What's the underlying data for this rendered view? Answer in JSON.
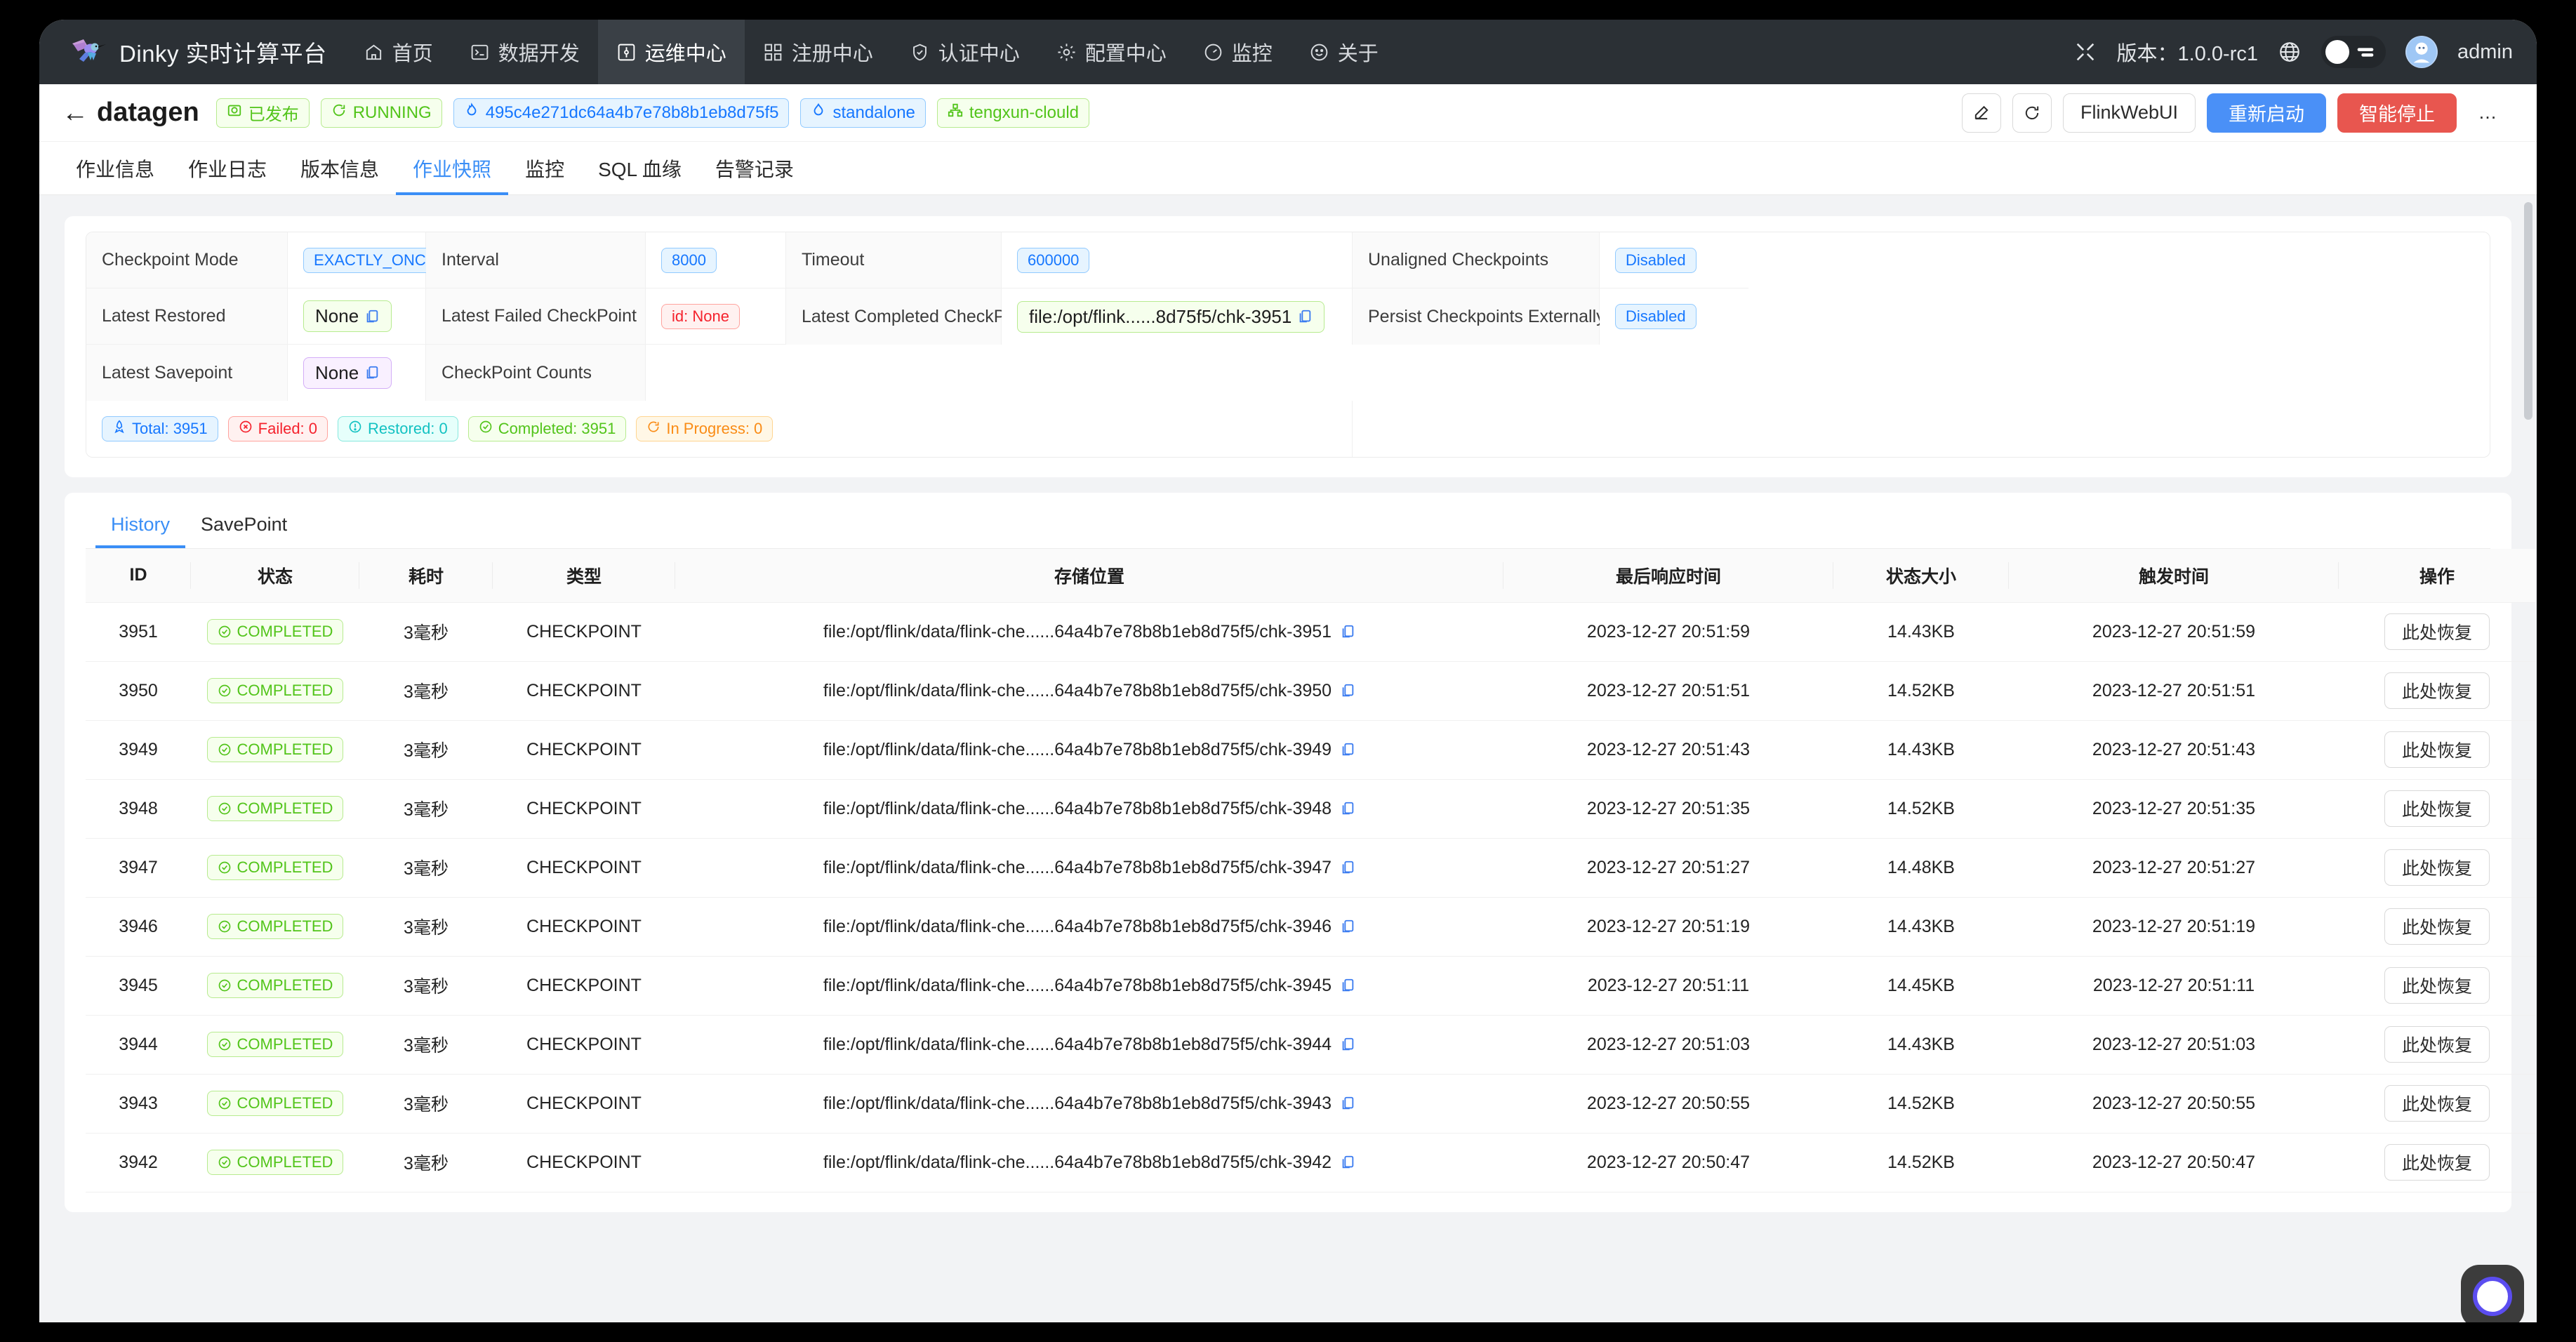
{
  "topnav": {
    "brand": "Dinky 实时计算平台",
    "items": [
      {
        "label": "首页",
        "icon": "home-icon",
        "active": false
      },
      {
        "label": "数据开发",
        "icon": "terminal-icon",
        "active": false
      },
      {
        "label": "运维中心",
        "icon": "ops-icon",
        "active": true
      },
      {
        "label": "注册中心",
        "icon": "registry-icon",
        "active": false
      },
      {
        "label": "认证中心",
        "icon": "shield-icon",
        "active": false
      },
      {
        "label": "配置中心",
        "icon": "gear-icon",
        "active": false
      },
      {
        "label": "监控",
        "icon": "dashboard-icon",
        "active": false
      },
      {
        "label": "关于",
        "icon": "smile-icon",
        "active": false
      }
    ],
    "version_label": "版本：1.0.0-rc1",
    "user": "admin"
  },
  "jobheader": {
    "title": "datagen",
    "tags": [
      {
        "label": "已发布",
        "color": "green",
        "icon": "publish-icon"
      },
      {
        "label": "RUNNING",
        "color": "green",
        "icon": "running-icon"
      },
      {
        "label": "495c4e271dc64a4b7e78b8b1eb8d75f5",
        "color": "blue",
        "icon": "fire-icon"
      },
      {
        "label": "standalone",
        "color": "blue",
        "icon": "cluster-icon"
      },
      {
        "label": "tengxun-clould",
        "color": "green",
        "icon": "group-icon"
      }
    ],
    "actions": {
      "edit": "edit-icon",
      "refresh": "refresh-icon",
      "flink_web_ui": "FlinkWebUI",
      "restart": "重新启动",
      "smart_stop": "智能停止",
      "more": "…"
    }
  },
  "tabs": [
    {
      "label": "作业信息",
      "active": false
    },
    {
      "label": "作业日志",
      "active": false
    },
    {
      "label": "版本信息",
      "active": false
    },
    {
      "label": "作业快照",
      "active": true
    },
    {
      "label": "监控",
      "active": false
    },
    {
      "label": "SQL 血缘",
      "active": false
    },
    {
      "label": "告警记录",
      "active": false
    }
  ],
  "checkpoint_info": {
    "row1": {
      "mode_label": "Checkpoint Mode",
      "mode_value": "EXACTLY_ONCE",
      "interval_label": "Interval",
      "interval_value": "8000",
      "timeout_label": "Timeout",
      "timeout_value": "600000",
      "unaligned_label": "Unaligned Checkpoints",
      "unaligned_value": "Disabled"
    },
    "row2": {
      "latest_restored_label": "Latest Restored",
      "latest_restored_value": "None",
      "latest_failed_label": "Latest Failed CheckPoint",
      "latest_failed_value": "id: None",
      "latest_completed_label": "Latest Completed CheckPoint",
      "latest_completed_value": "file:/opt/flink......8d75f5/chk-3951",
      "persist_label": "Persist Checkpoints Externally Enabled",
      "persist_value": "Disabled"
    },
    "row3": {
      "latest_savepoint_label": "Latest Savepoint",
      "latest_savepoint_value": "None",
      "counts_label": "CheckPoint Counts",
      "counts": [
        {
          "label": "Total: 3951",
          "color": "blue",
          "icon": "rocket-icon"
        },
        {
          "label": "Failed: 0",
          "color": "red",
          "icon": "close-circle-icon"
        },
        {
          "label": "Restored: 0",
          "color": "cyan",
          "icon": "exclamation-circle-icon"
        },
        {
          "label": "Completed: 3951",
          "color": "green",
          "icon": "check-circle-icon"
        },
        {
          "label": "In Progress: 0",
          "color": "orange",
          "icon": "loading-icon"
        }
      ]
    }
  },
  "subtabs": [
    {
      "label": "History",
      "active": true
    },
    {
      "label": "SavePoint",
      "active": false
    }
  ],
  "table": {
    "columns": [
      "ID",
      "状态",
      "耗时",
      "类型",
      "存储位置",
      "最后响应时间",
      "状态大小",
      "触发时间",
      "操作"
    ],
    "action_label": "此处恢复",
    "rows": [
      {
        "id": "3951",
        "status": "COMPLETED",
        "duration": "3毫秒",
        "type": "CHECKPOINT",
        "path": "file:/opt/flink/data/flink-che......64a4b7e78b8b1eb8d75f5/chk-3951",
        "last_ack": "2023-12-27 20:51:59",
        "size": "14.43KB",
        "trigger": "2023-12-27 20:51:59"
      },
      {
        "id": "3950",
        "status": "COMPLETED",
        "duration": "3毫秒",
        "type": "CHECKPOINT",
        "path": "file:/opt/flink/data/flink-che......64a4b7e78b8b1eb8d75f5/chk-3950",
        "last_ack": "2023-12-27 20:51:51",
        "size": "14.52KB",
        "trigger": "2023-12-27 20:51:51"
      },
      {
        "id": "3949",
        "status": "COMPLETED",
        "duration": "3毫秒",
        "type": "CHECKPOINT",
        "path": "file:/opt/flink/data/flink-che......64a4b7e78b8b1eb8d75f5/chk-3949",
        "last_ack": "2023-12-27 20:51:43",
        "size": "14.43KB",
        "trigger": "2023-12-27 20:51:43"
      },
      {
        "id": "3948",
        "status": "COMPLETED",
        "duration": "3毫秒",
        "type": "CHECKPOINT",
        "path": "file:/opt/flink/data/flink-che......64a4b7e78b8b1eb8d75f5/chk-3948",
        "last_ack": "2023-12-27 20:51:35",
        "size": "14.52KB",
        "trigger": "2023-12-27 20:51:35"
      },
      {
        "id": "3947",
        "status": "COMPLETED",
        "duration": "3毫秒",
        "type": "CHECKPOINT",
        "path": "file:/opt/flink/data/flink-che......64a4b7e78b8b1eb8d75f5/chk-3947",
        "last_ack": "2023-12-27 20:51:27",
        "size": "14.48KB",
        "trigger": "2023-12-27 20:51:27"
      },
      {
        "id": "3946",
        "status": "COMPLETED",
        "duration": "3毫秒",
        "type": "CHECKPOINT",
        "path": "file:/opt/flink/data/flink-che......64a4b7e78b8b1eb8d75f5/chk-3946",
        "last_ack": "2023-12-27 20:51:19",
        "size": "14.43KB",
        "trigger": "2023-12-27 20:51:19"
      },
      {
        "id": "3945",
        "status": "COMPLETED",
        "duration": "3毫秒",
        "type": "CHECKPOINT",
        "path": "file:/opt/flink/data/flink-che......64a4b7e78b8b1eb8d75f5/chk-3945",
        "last_ack": "2023-12-27 20:51:11",
        "size": "14.45KB",
        "trigger": "2023-12-27 20:51:11"
      },
      {
        "id": "3944",
        "status": "COMPLETED",
        "duration": "3毫秒",
        "type": "CHECKPOINT",
        "path": "file:/opt/flink/data/flink-che......64a4b7e78b8b1eb8d75f5/chk-3944",
        "last_ack": "2023-12-27 20:51:03",
        "size": "14.43KB",
        "trigger": "2023-12-27 20:51:03"
      },
      {
        "id": "3943",
        "status": "COMPLETED",
        "duration": "3毫秒",
        "type": "CHECKPOINT",
        "path": "file:/opt/flink/data/flink-che......64a4b7e78b8b1eb8d75f5/chk-3943",
        "last_ack": "2023-12-27 20:50:55",
        "size": "14.52KB",
        "trigger": "2023-12-27 20:50:55"
      },
      {
        "id": "3942",
        "status": "COMPLETED",
        "duration": "3毫秒",
        "type": "CHECKPOINT",
        "path": "file:/opt/flink/data/flink-che......64a4b7e78b8b1eb8d75f5/chk-3942",
        "last_ack": "2023-12-27 20:50:47",
        "size": "14.52KB",
        "trigger": "2023-12-27 20:50:47"
      }
    ]
  },
  "colors": {
    "nav_bg": "#2b3035",
    "accent": "#3a8ef6",
    "primary_btn": "#4a90f7",
    "danger_btn": "#e8564f",
    "page_bg": "#f2f3f5"
  }
}
